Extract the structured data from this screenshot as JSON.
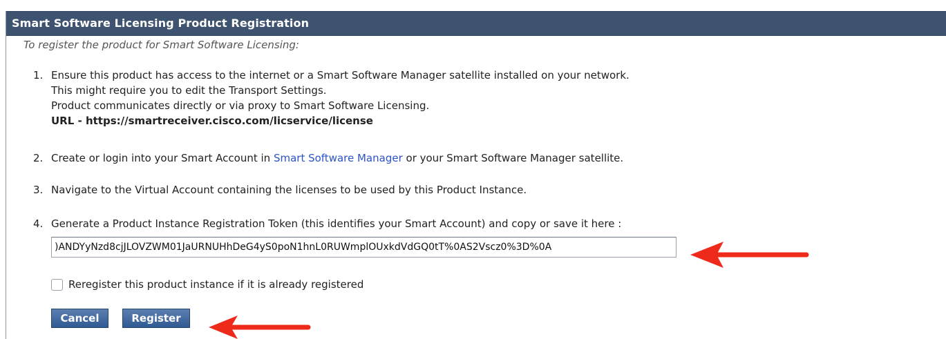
{
  "header": {
    "title": "Smart Software Licensing Product Registration"
  },
  "intro": "To register the product for Smart Software Licensing:",
  "steps": {
    "s1": {
      "num": "1.",
      "lines": [
        "Ensure this product has access to the internet or a Smart Software Manager satellite installed on your network.",
        "This might require you to edit the Transport Settings.",
        "Product communicates directly or via proxy to Smart Software Licensing."
      ],
      "url": "URL - https://smartreceiver.cisco.com/licservice/license"
    },
    "s2": {
      "num": "2.",
      "pre": "Create or login into your Smart Account in ",
      "link": "Smart Software Manager",
      "post": " or your Smart Software Manager satellite."
    },
    "s3": {
      "num": "3.",
      "text": "Navigate to the Virtual Account containing the licenses to be used by this Product Instance."
    },
    "s4": {
      "num": "4.",
      "text": "Generate a Product Instance Registration Token (this identifies your Smart Account) and copy or save it here :"
    }
  },
  "token": {
    "value": ")ANDYyNzd8cjJLOVZWM01JaURNUHhDeG4yS0poN1hnL0RUWmplOUxkdVdGQ0tT%0AS2Vscz0%3D%0A"
  },
  "reregister": {
    "label": "Reregister this product instance if it is already registered",
    "checked": false
  },
  "buttons": {
    "cancel": "Cancel",
    "register": "Register"
  },
  "colors": {
    "header_bg": "#3d536f",
    "button_bg": "#2f5a93",
    "link": "#2b53c9",
    "arrow": "#ee2a1b"
  }
}
